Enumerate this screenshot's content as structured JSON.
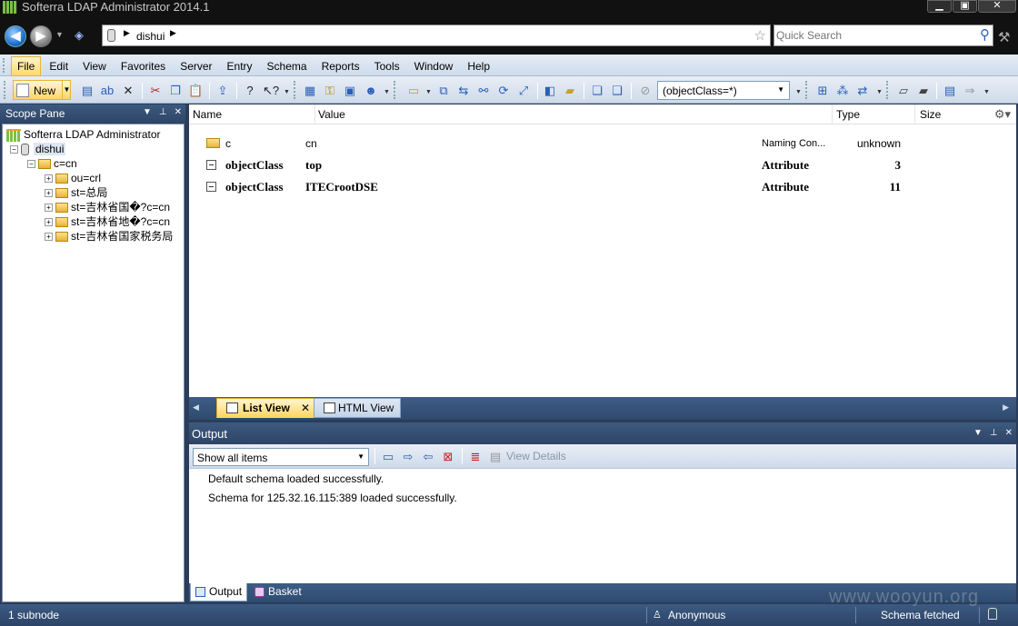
{
  "window": {
    "title": "Softerra LDAP Administrator 2014.1",
    "controls": [
      "▁",
      "▣",
      "✕"
    ]
  },
  "address": {
    "crumb": "dishui",
    "search_placeholder": "Quick Search"
  },
  "menu": {
    "items": [
      "File",
      "Edit",
      "View",
      "Favorites",
      "Server",
      "Entry",
      "Schema",
      "Reports",
      "Tools",
      "Window",
      "Help"
    ]
  },
  "toolbar": {
    "new_label": "New",
    "filter_value": "(objectClass=*)"
  },
  "scope": {
    "title": "Scope Pane",
    "root": "Softerra LDAP Administrator",
    "server": "dishui",
    "base": "c=cn",
    "children": [
      "ou=crl",
      "st=总局",
      "st=吉林省国�?c=cn",
      "st=吉林省地�?c=cn",
      "st=吉林省国家税务局"
    ]
  },
  "list": {
    "columns": [
      "Name",
      "Value",
      "Type",
      "Size"
    ],
    "rows": [
      {
        "icon": "folder",
        "name": "c",
        "value": "cn",
        "type": "Naming Con...",
        "size": "unknown",
        "bold": false
      },
      {
        "icon": "attribute",
        "name": "objectClass",
        "value": "top",
        "type": "Attribute",
        "size": "3",
        "bold": true
      },
      {
        "icon": "attribute",
        "name": "objectClass",
        "value": "ITECrootDSE",
        "type": "Attribute",
        "size": "11",
        "bold": true
      }
    ]
  },
  "view_tabs": {
    "list_view": "List View",
    "html_view": "HTML View"
  },
  "output": {
    "title": "Output",
    "filter_value": "Show all items",
    "view_details": "View Details",
    "lines": [
      "Default schema loaded successfully.",
      "Schema for 125.32.16.115:389 loaded successfully."
    ],
    "tabs": [
      "Output",
      "Basket"
    ]
  },
  "status": {
    "left": "1 subnode",
    "user": "Anonymous",
    "schema": "Schema fetched"
  },
  "watermark": "www.wooyun.org"
}
